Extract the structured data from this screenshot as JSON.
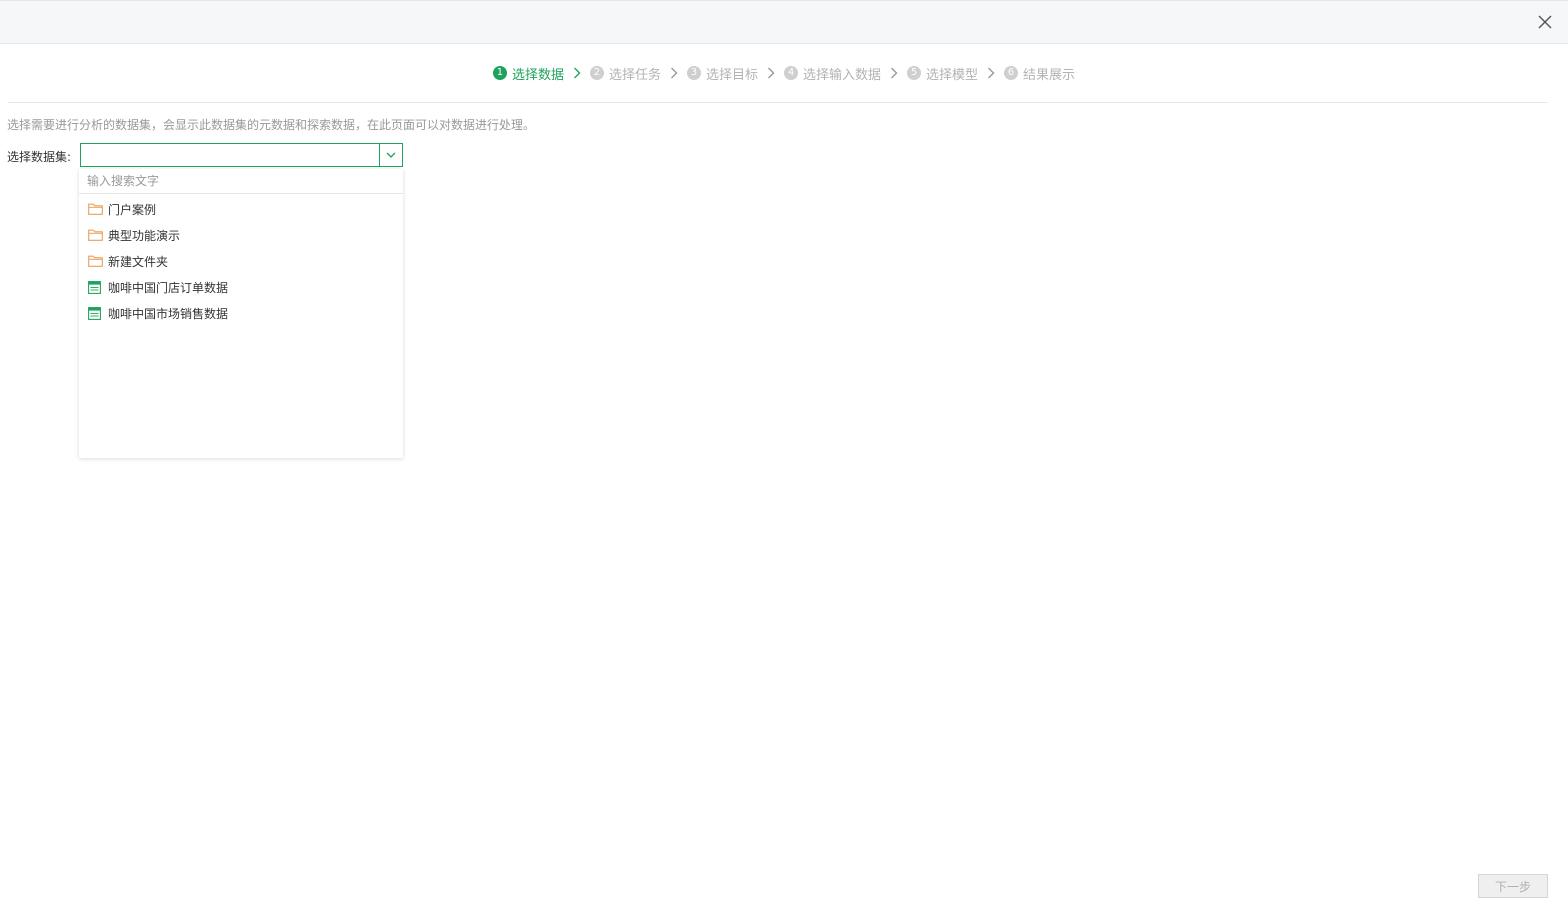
{
  "steps": [
    {
      "num": "1",
      "label": "选择数据",
      "active": true
    },
    {
      "num": "2",
      "label": "选择任务",
      "active": false
    },
    {
      "num": "3",
      "label": "选择目标",
      "active": false
    },
    {
      "num": "4",
      "label": "选择输入数据",
      "active": false
    },
    {
      "num": "5",
      "label": "选择模型",
      "active": false
    },
    {
      "num": "6",
      "label": "结果展示",
      "active": false
    }
  ],
  "hint": "选择需要进行分析的数据集，会显示此数据集的元数据和探索数据，在此页面可以对数据进行处理。",
  "dataset_field": {
    "label": "选择数据集:",
    "value": ""
  },
  "dropdown": {
    "search_placeholder": "输入搜索文字",
    "items": [
      {
        "label": "门户案例",
        "icon": "folder-icon"
      },
      {
        "label": "典型功能演示",
        "icon": "folder-icon"
      },
      {
        "label": "新建文件夹",
        "icon": "folder-icon"
      },
      {
        "label": "咖啡中国门店订单数据",
        "icon": "sql-dataset-icon"
      },
      {
        "label": "咖啡中国市场销售数据",
        "icon": "sql-dataset-icon"
      }
    ]
  },
  "next_button": "下一步",
  "colors": {
    "accent": "#1fa35c",
    "folder": "#e8a15a",
    "inactive": "#b3b3b3"
  }
}
